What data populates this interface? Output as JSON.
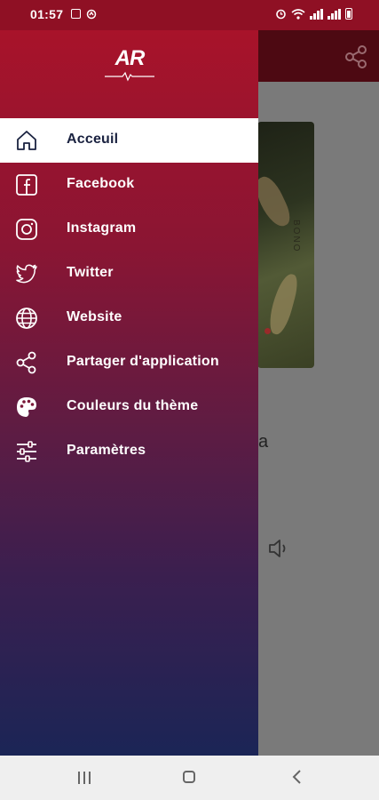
{
  "status_bar": {
    "time": "01:57",
    "left_icons": [
      "image-icon",
      "sync-icon"
    ],
    "right_icons": [
      "alarm-icon",
      "wifi-icon",
      "signal-icon",
      "signal-icon",
      "battery-icon"
    ]
  },
  "drawer": {
    "logo_text": "AR",
    "items": [
      {
        "label": "Acceuil",
        "icon": "home-icon",
        "active": true
      },
      {
        "label": "Facebook",
        "icon": "facebook-icon",
        "active": false
      },
      {
        "label": "Instagram",
        "icon": "instagram-icon",
        "active": false
      },
      {
        "label": "Twitter",
        "icon": "twitter-icon",
        "active": false
      },
      {
        "label": "Website",
        "icon": "globe-icon",
        "active": false
      },
      {
        "label": "Partager d'application",
        "icon": "share-icon",
        "active": false
      },
      {
        "label": "Couleurs du thème",
        "icon": "palette-icon",
        "active": false
      },
      {
        "label": "Paramètres",
        "icon": "sliders-icon",
        "active": false
      }
    ]
  },
  "background": {
    "visible_letter": "a",
    "artwork_text": "BONO"
  },
  "colors": {
    "accent": "#a8132a",
    "active_text": "#1a2240",
    "gradient_bottom": "#1b2556"
  },
  "nav_bar": {
    "buttons": [
      "recents-icon",
      "home-icon",
      "back-icon"
    ]
  }
}
